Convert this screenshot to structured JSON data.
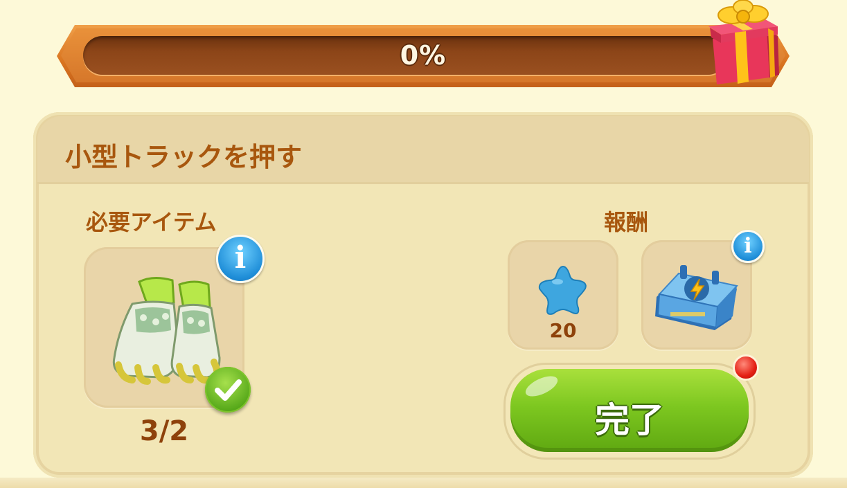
{
  "progress": {
    "percent_text": "0%",
    "fraction": 0.0
  },
  "task": {
    "title": "小型トラックを押す"
  },
  "required": {
    "label": "必要アイテム",
    "item_icon": "gardening-gloves-icon",
    "count": "3/2"
  },
  "reward": {
    "label": "報酬",
    "items": [
      {
        "icon": "blue-star-icon",
        "amount": "20"
      },
      {
        "icon": "energy-toolbox-icon"
      }
    ]
  },
  "complete_button": {
    "label": "完了"
  },
  "colors": {
    "accent_brown": "#a8570e",
    "button_green": "#7dc720",
    "info_blue": "#1f8ed8",
    "alert_red": "#e41f14"
  }
}
